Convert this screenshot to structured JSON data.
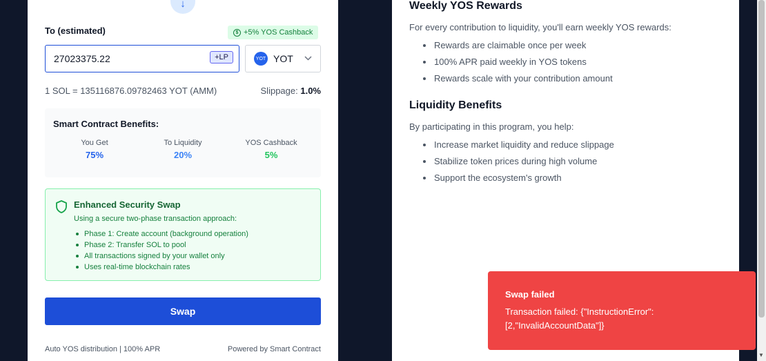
{
  "swap": {
    "to_label": "To (estimated)",
    "cashback_badge": "+5% YOS Cashback",
    "amount_value": "27023375.22",
    "lp_tag": "+LP",
    "token": "YOT",
    "token_logo_text": "YOT",
    "rate": "1 SOL = 135116876.09782463 YOT (AMM)",
    "slippage_label": "Slippage:",
    "slippage_value": "1.0%",
    "swap_button": "Swap",
    "footer_left": "Auto YOS distribution | 100% APR",
    "footer_right": "Powered by Smart Contract"
  },
  "benefits": {
    "title": "Smart Contract Benefits:",
    "items": [
      {
        "label": "You Get",
        "value": "75%",
        "color": "#2563eb"
      },
      {
        "label": "To Liquidity",
        "value": "20%",
        "color": "#3b82f6"
      },
      {
        "label": "YOS Cashback",
        "value": "5%",
        "color": "#22c55e"
      }
    ]
  },
  "security": {
    "title": "Enhanced Security Swap",
    "description": "Using a secure two-phase transaction approach:",
    "items": [
      "Phase 1: Create account (background operation)",
      "Phase 2: Transfer SOL to pool",
      "All transactions signed by your wallet only",
      "Uses real-time blockchain rates"
    ]
  },
  "info": {
    "rewards_title": "Weekly YOS Rewards",
    "rewards_desc": "For every contribution to liquidity, you'll earn weekly YOS rewards:",
    "rewards_items": [
      "Rewards are claimable once per week",
      "100% APR paid weekly in YOS tokens",
      "Rewards scale with your contribution amount"
    ],
    "liquidity_title": "Liquidity Benefits",
    "liquidity_desc": "By participating in this program, you help:",
    "liquidity_items": [
      "Increase market liquidity and reduce slippage",
      "Stabilize token prices during high volume",
      "Support the ecosystem's growth"
    ]
  },
  "toast": {
    "title": "Swap failed",
    "message": "Transaction failed: {\"InstructionError\":[2,\"InvalidAccountData\"]}"
  },
  "icons": {
    "arrow": "arrow-down-icon",
    "dollar": "dollar-circle-icon",
    "shield": "shield-icon",
    "chevron": "chevron-down-icon"
  }
}
